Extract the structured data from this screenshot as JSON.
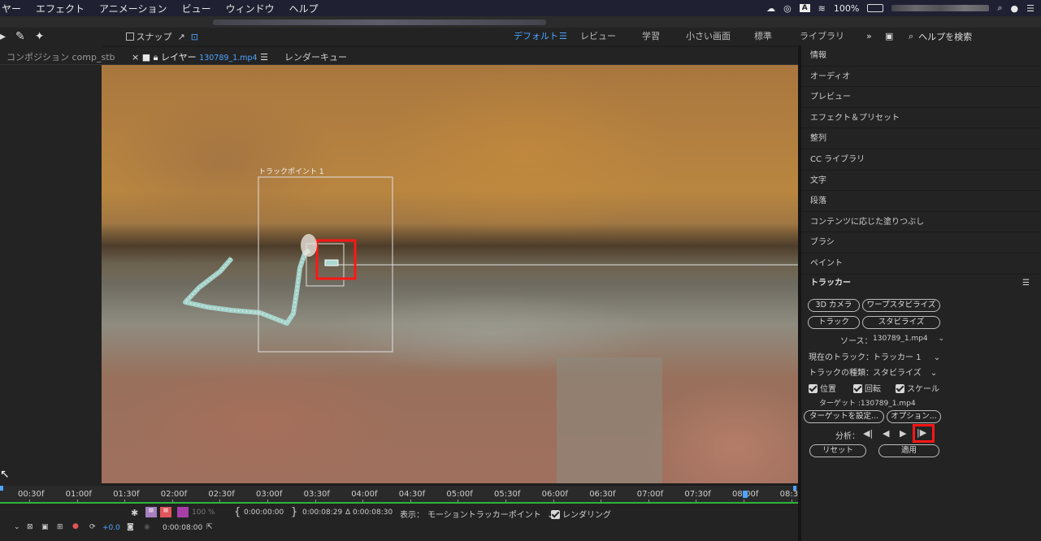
{
  "menubar": {
    "items": [
      "ヤー",
      "エフェクト",
      "アニメーション",
      "ビュー",
      "ウィンドウ",
      "ヘルプ"
    ],
    "battery": "100%"
  },
  "toolbar": {
    "snap_label": "スナップ",
    "workspaces": [
      "デフォルト",
      "レビュー",
      "学習",
      "小さい画面",
      "標準",
      "ライブラリ"
    ],
    "search_placeholder": "ヘルプを検索"
  },
  "tabs": {
    "composition_label": "コンポジション",
    "composition_name": "comp_stb",
    "layer_label": "レイヤー",
    "layer_name": "130789_1.mp4",
    "render_queue": "レンダーキュー"
  },
  "viewer": {
    "track_point_label": "トラックポイント 1"
  },
  "right_panel": {
    "sections": [
      "情報",
      "オーディオ",
      "プレビュー",
      "エフェクト＆プリセット",
      "整列",
      "CC ライブラリ",
      "文字",
      "段落",
      "コンテンツに応じた塗りつぶし",
      "ブラシ",
      "ペイント"
    ],
    "tracker": {
      "title": "トラッカー",
      "btn_3d_camera": "3D カメラ",
      "btn_warp": "ワープスタビライズ",
      "btn_track": "トラック",
      "btn_stabilize": "スタビライズ",
      "source_label": "ソース：",
      "source_value": "130789_1.mp4",
      "current_track_label": "現在のトラック：",
      "current_track_value": "トラッカー 1",
      "track_type_label": "トラックの種類：",
      "track_type_value": "スタビライズ",
      "opt_position": "位置",
      "opt_rotation": "回転",
      "opt_scale": "スケール",
      "target_text": "ターゲット :130789_1.mp4",
      "btn_set_target": "ターゲットを設定...",
      "btn_options": "オプション...",
      "analyze_label": "分析：",
      "btn_reset": "リセット",
      "btn_apply": "適用"
    }
  },
  "timeline": {
    "ticks": [
      "00:30f",
      "01:00f",
      "01:30f",
      "02:00f",
      "02:30f",
      "03:00f",
      "03:30f",
      "04:00f",
      "04:30f",
      "05:00f",
      "05:30f",
      "06:00f",
      "06:30f",
      "07:00f",
      "07:30f",
      "08:00f",
      "08:3"
    ],
    "zoom": "100 %",
    "in_time": "0:00:00:00",
    "out_time": "0:00:08:29",
    "duration": "Δ 0:00:08:30",
    "display_label": "表示：",
    "display_value": "モーショントラッカーポイント",
    "render_label": "レンダリング",
    "exposure": "+0.0",
    "current_time": "0:00:08:00"
  },
  "colors": {
    "accent": "#4ea4ff",
    "highlight": "#ff1616",
    "track_path": "#a8d8d0",
    "progress": "#2eb33a"
  }
}
